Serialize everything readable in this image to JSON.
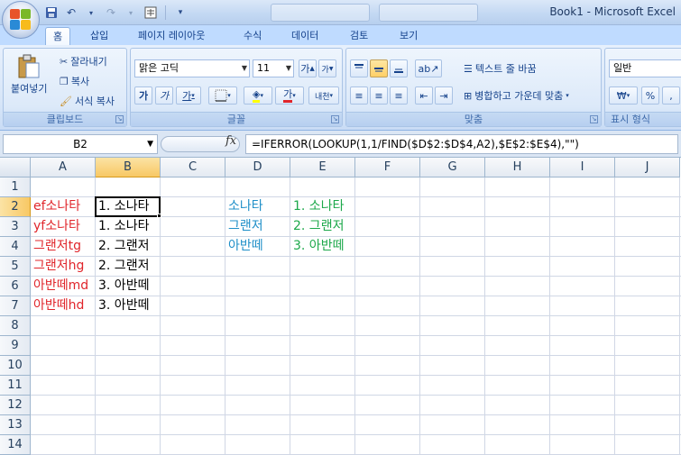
{
  "window": {
    "title": "Book1 - Microsoft Excel"
  },
  "ribbon_tabs": [
    "홈",
    "삽입",
    "페이지 레이아웃",
    "수식",
    "데이터",
    "검토",
    "보기"
  ],
  "clipboard": {
    "paste_label": "붙여넣기",
    "cut_label": "잘라내기",
    "copy_label": "복사",
    "format_painter_label": "서식 복사",
    "group_label": "클립보드"
  },
  "font": {
    "font_name": "맑은 고딕",
    "font_size": "11",
    "bold": "가",
    "italic": "가",
    "underline": "가",
    "grow": "가",
    "shrink": "가",
    "font_color_glyph": "가",
    "phonetic": "내천",
    "group_label": "글꼴"
  },
  "alignment": {
    "wrap_text_label": "텍스트 줄 바꿈",
    "merge_label": "병합하고 가운데 맞춤",
    "group_label": "맞춤"
  },
  "number": {
    "format": "일반",
    "currency": "₩",
    "percent": "%",
    "comma": ",",
    "group_label": "표시 형식"
  },
  "formula_bar": {
    "name_box": "B2",
    "fx": "fx",
    "formula": "=IFERROR(LOOKUP(1,1/FIND($D$2:$D$4,A2),$E$2:$E$4),\"\")"
  },
  "sheet": {
    "columns": [
      "A",
      "B",
      "C",
      "D",
      "E",
      "F",
      "G",
      "H",
      "I",
      "J"
    ],
    "rows": [
      "1",
      "2",
      "3",
      "4",
      "5",
      "6",
      "7",
      "8",
      "9",
      "10",
      "11",
      "12",
      "13",
      "14"
    ],
    "selected_cell": "B2",
    "col_A": [
      "ef소나타",
      "yf소나타",
      "그랜저tg",
      "그랜저hg",
      "아반떼md",
      "아반떼hd"
    ],
    "col_B": [
      "1. 소나타",
      "1. 소나타",
      "2. 그랜저",
      "2. 그랜저",
      "3. 아반떼",
      "3. 아반떼"
    ],
    "col_D": [
      "소나타",
      "그랜저",
      "아반떼"
    ],
    "col_E": [
      "1. 소나타",
      "2. 그랜저",
      "3. 아반떼"
    ]
  },
  "colors": {
    "col_A_text": "#e0252b",
    "col_D_text": "#1f8fc8",
    "col_E_text": "#1ca84a",
    "selection_header": "#f8c864"
  }
}
